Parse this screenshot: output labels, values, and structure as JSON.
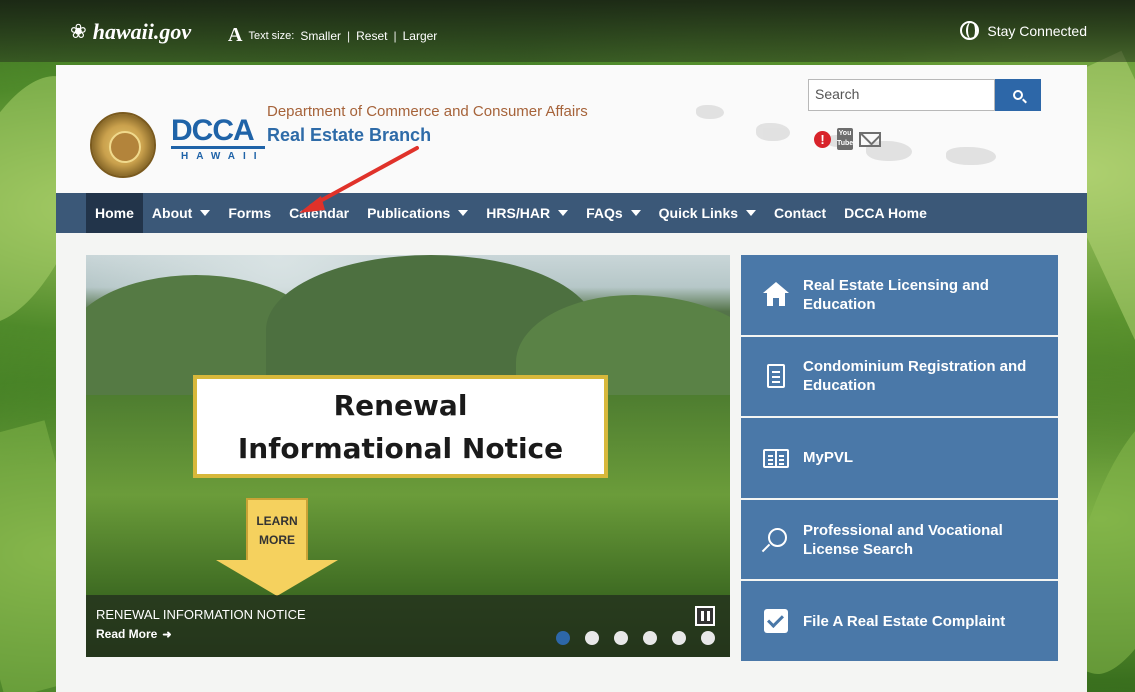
{
  "topbar": {
    "site_logo": "hawaii.gov",
    "text_size_label": "Text size:",
    "text_size_options": [
      "Smaller",
      "Reset",
      "Larger"
    ],
    "text_size_separator": "|",
    "stay_connected": "Stay Connected"
  },
  "header": {
    "department": "Department of Commerce and Consumer Affairs",
    "branch": "Real Estate Branch",
    "dcca_logo": "DCCA",
    "dcca_sub": "HAWAII",
    "search_placeholder": "Search"
  },
  "social_icons": [
    "alert-icon",
    "youtube-icon",
    "mail-icon"
  ],
  "youtube_label_top": "You",
  "youtube_label_bottom": "Tube",
  "alert_glyph": "!",
  "nav": [
    {
      "label": "Home",
      "dropdown": false,
      "active": true
    },
    {
      "label": "About",
      "dropdown": true
    },
    {
      "label": "Forms",
      "dropdown": false
    },
    {
      "label": "Calendar",
      "dropdown": false
    },
    {
      "label": "Publications",
      "dropdown": true
    },
    {
      "label": "HRS/HAR",
      "dropdown": true
    },
    {
      "label": "FAQs",
      "dropdown": true
    },
    {
      "label": "Quick Links",
      "dropdown": true
    },
    {
      "label": "Contact",
      "dropdown": false
    },
    {
      "label": "DCCA Home",
      "dropdown": false
    }
  ],
  "hero": {
    "notice_line1": "Renewal",
    "notice_line2": "Informational Notice",
    "learn_line1": "LEARN",
    "learn_line2": "MORE",
    "caption_title": "RENEWAL INFORMATION NOTICE",
    "caption_link": "Read More",
    "slide_count": 6,
    "active_slide": 1
  },
  "quick_links": [
    {
      "label": "Real Estate Licensing and Education",
      "icon": "house-icon"
    },
    {
      "label": "Condominium Registration and Education",
      "icon": "document-icon"
    },
    {
      "label": "MyPVL",
      "icon": "book-icon"
    },
    {
      "label": "Professional and Vocational License Search",
      "icon": "search-icon"
    },
    {
      "label": "File A Real Estate Complaint",
      "icon": "checkbox-icon"
    }
  ],
  "colors": {
    "nav_bg": "#3b5878",
    "nav_active": "#22344a",
    "accent_blue": "#2d67a8",
    "card_blue": "#4a78a8",
    "dept_text": "#a6633a",
    "annotation_arrow": "#e0322a"
  }
}
